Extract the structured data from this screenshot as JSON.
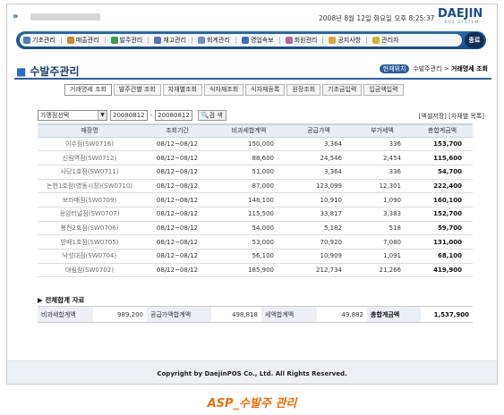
{
  "header": {
    "datetime": "2008년 8월 12일 화요일 오후 8:25:37",
    "logo_text": "DAEJIN",
    "logo_sub": "POS SYSTEM",
    "nav_arrows": "»"
  },
  "nav": {
    "items": [
      {
        "label": "기초관리",
        "color": "#4b7fc0",
        "icon": "folder-icon"
      },
      {
        "label": "매출관리",
        "color": "#c98a2e",
        "icon": "sales-icon"
      },
      {
        "label": "발주관리",
        "color": "#3f9a52",
        "icon": "order-icon"
      },
      {
        "label": "재고관리",
        "color": "#5577a8",
        "icon": "stock-icon"
      },
      {
        "label": "회계관리",
        "color": "#6d8fb8",
        "icon": "accounting-icon"
      },
      {
        "label": "영업속보",
        "color": "#3d6fb0",
        "icon": "news-icon"
      },
      {
        "label": "회원관리",
        "color": "#b06a9a",
        "icon": "member-icon"
      },
      {
        "label": "공지사항",
        "color": "#d9a43b",
        "icon": "notice-icon"
      },
      {
        "label": "관리자",
        "color": "#d8b23a",
        "icon": "admin-icon"
      }
    ],
    "exit_label": "종료"
  },
  "page": {
    "title": "수발주관리",
    "breadcrumb_here": "현재위치",
    "breadcrumb_path": "수발주관리 > ",
    "breadcrumb_current": "거래명세 조회"
  },
  "tabs": [
    "거래명세 조회",
    "발주건별 조회",
    "자재별조회",
    "식자재조회",
    "식자재등록",
    "원장조회",
    "기초금입력",
    "입금액입력"
  ],
  "filter": {
    "store_select": "가맹점선택",
    "date_from": "20080812",
    "date_to": "20080812",
    "date_sep": "-",
    "search_label": "검 색",
    "export_links": "[엑셀저장] [자재별 목록]"
  },
  "table": {
    "headers": [
      "매장명",
      "조회기간",
      "비과세합계액",
      "공급가액",
      "부가세액",
      "총합계금액"
    ],
    "rows": [
      [
        "이수점(SW0716)",
        "08/12~08/12",
        "150,000",
        "3,364",
        "336",
        "153,700"
      ],
      [
        "신림역점(SW0712)",
        "08/12~08/12",
        "88,600",
        "24,546",
        "2,454",
        "115,600"
      ],
      [
        "사당1호점(SW0711)",
        "08/12~08/12",
        "51,000",
        "3,364",
        "336",
        "54,700"
      ],
      [
        "논현1호점(영동시장)(SW0710)",
        "08/12~08/12",
        "87,000",
        "123,099",
        "12,301",
        "222,400"
      ],
      [
        "보라매점(SW0709)",
        "08/12~08/12",
        "148,100",
        "10,910",
        "1,090",
        "160,100"
      ],
      [
        "응암터널점(SW0707)",
        "08/12~08/12",
        "115,500",
        "33,817",
        "3,383",
        "152,700"
      ],
      [
        "봉천2호점(SW0706)",
        "08/12~08/12",
        "54,000",
        "5,182",
        "518",
        "59,700"
      ],
      [
        "방배1호점(SW0705)",
        "08/12~08/12",
        "53,000",
        "70,920",
        "7,080",
        "131,000"
      ],
      [
        "낙성대점(SW0704)",
        "08/12~08/12",
        "56,100",
        "10,909",
        "1,091",
        "68,100"
      ],
      [
        "대림점(SW0702)",
        "08/12~08/12",
        "185,900",
        "212,734",
        "21,266",
        "419,900"
      ]
    ]
  },
  "totals": {
    "title": "▶ 전체합계 자료",
    "items": [
      {
        "label": "비과세합계액",
        "value": "989,200"
      },
      {
        "label": "공급가액합계액",
        "value": "498,818"
      },
      {
        "label": "세액합계액",
        "value": "49,882"
      },
      {
        "label": "총합계금액",
        "value": "1,537,900"
      }
    ]
  },
  "footer": {
    "copyright": "Copyright by DaejinPOS Co., Ltd. All Rights Reserved."
  },
  "caption": "ASP_수발주 관리"
}
